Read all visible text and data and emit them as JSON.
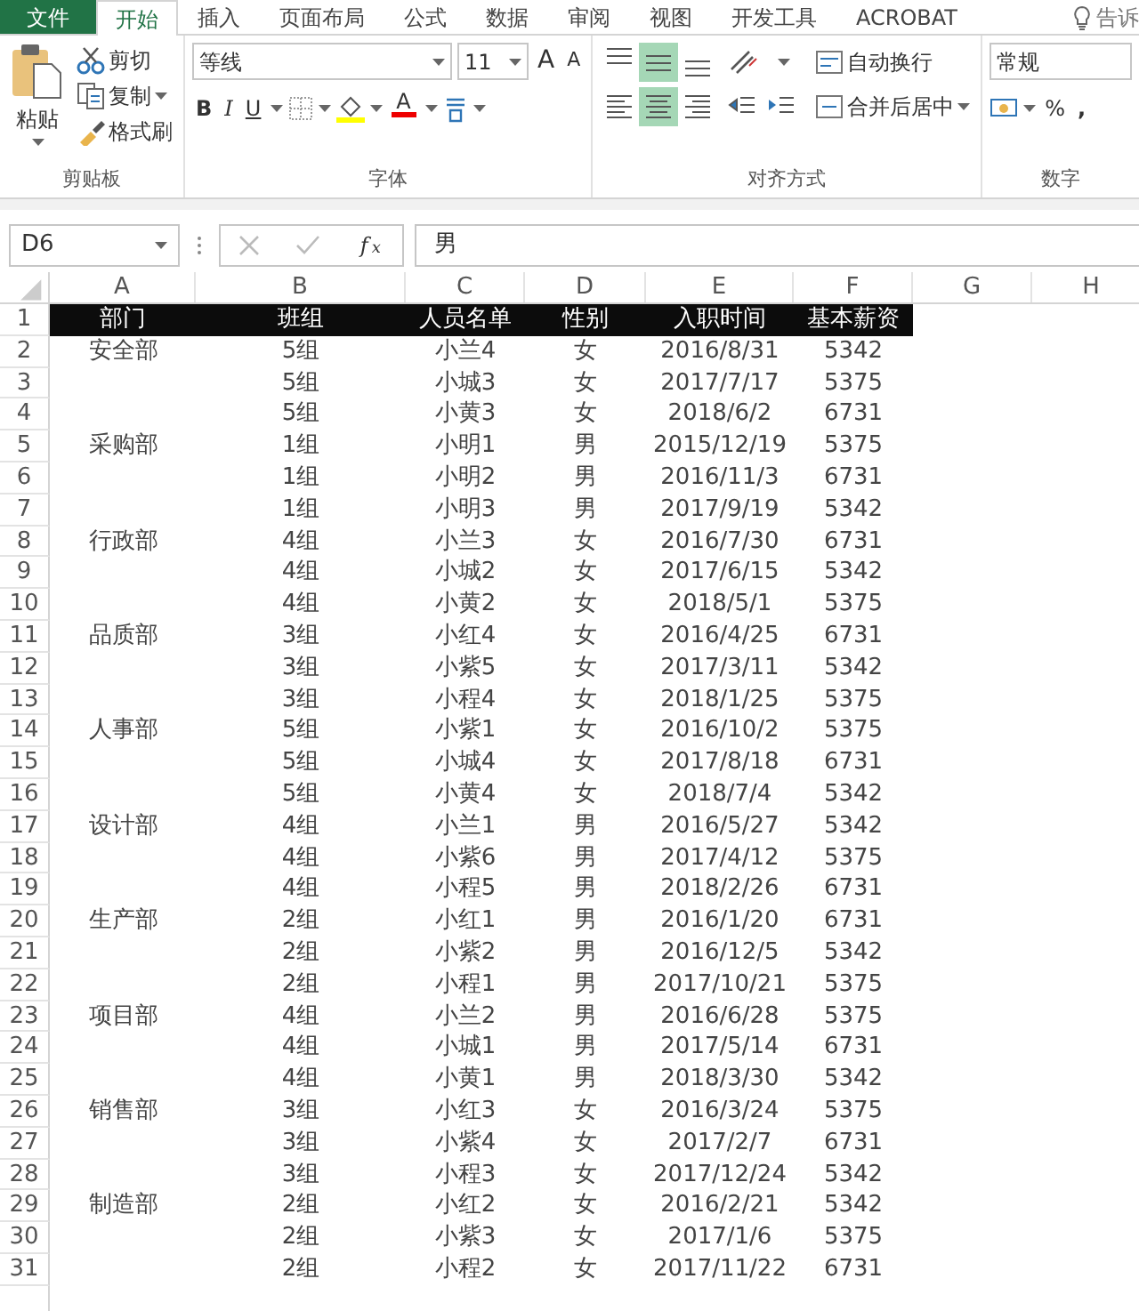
{
  "tabs": [
    {
      "label": "文件",
      "kind": "file",
      "selected": false
    },
    {
      "label": "开始",
      "kind": "tab",
      "selected": true
    },
    {
      "label": "插入",
      "kind": "tab",
      "selected": false
    },
    {
      "label": "页面布局",
      "kind": "tab",
      "selected": false
    },
    {
      "label": "公式",
      "kind": "tab",
      "selected": false
    },
    {
      "label": "数据",
      "kind": "tab",
      "selected": false
    },
    {
      "label": "审阅",
      "kind": "tab",
      "selected": false
    },
    {
      "label": "视图",
      "kind": "tab",
      "selected": false
    },
    {
      "label": "开发工具",
      "kind": "tab",
      "selected": false
    },
    {
      "label": "ACROBAT",
      "kind": "tab",
      "selected": false
    }
  ],
  "tell_me": "告诉",
  "clipboard": {
    "paste": "粘贴",
    "cut": "剪切",
    "copy": "复制",
    "format_painter": "格式刷",
    "label": "剪贴板"
  },
  "font": {
    "name": "等线",
    "size": "11",
    "grow": "A",
    "shrink": "A",
    "bold": "B",
    "italic": "I",
    "underline": "U",
    "color_letter": "A",
    "label": "字体"
  },
  "alignment": {
    "vertical": [
      {
        "kind": "top",
        "selected": false
      },
      {
        "kind": "middle",
        "selected": true
      },
      {
        "kind": "bottom",
        "selected": false
      }
    ],
    "horizontal": [
      {
        "kind": "left",
        "selected": false
      },
      {
        "kind": "center",
        "selected": true
      },
      {
        "kind": "right",
        "selected": false
      }
    ],
    "wrap": "自动换行",
    "merge": "合并后居中",
    "label": "对齐方式"
  },
  "number": {
    "format": "常规",
    "percent": "%",
    "comma": ",",
    "label": "数字"
  },
  "formula_bar": {
    "name_box": "D6",
    "fx": "f$_{x}$",
    "value": "男"
  },
  "sheet": {
    "columns": [
      "A",
      "B",
      "C",
      "D",
      "E",
      "F",
      "G",
      "H"
    ],
    "header": {
      "row": "1",
      "cells": [
        "部门",
        "班组",
        "人员名单",
        "性别",
        "入职时间",
        "基本薪资"
      ]
    },
    "rows": [
      {
        "row": "2",
        "department": "安全部",
        "group": "5组",
        "name": "小兰4",
        "gender": "女",
        "hire_date": "2016/8/31",
        "salary": "5342"
      },
      {
        "row": "3",
        "group": "5组",
        "name": "小城3",
        "gender": "女",
        "hire_date": "2017/7/17",
        "salary": "5375"
      },
      {
        "row": "4",
        "group": "5组",
        "name": "小黄3",
        "gender": "女",
        "hire_date": "2018/6/2",
        "salary": "6731"
      },
      {
        "row": "5",
        "department": "采购部",
        "group": "1组",
        "name": "小明1",
        "gender": "男",
        "hire_date": "2015/12/19",
        "salary": "5375"
      },
      {
        "row": "6",
        "group": "1组",
        "name": "小明2",
        "gender": "男",
        "hire_date": "2016/11/3",
        "salary": "6731"
      },
      {
        "row": "7",
        "group": "1组",
        "name": "小明3",
        "gender": "男",
        "hire_date": "2017/9/19",
        "salary": "5342"
      },
      {
        "row": "8",
        "department": "行政部",
        "group": "4组",
        "name": "小兰3",
        "gender": "女",
        "hire_date": "2016/7/30",
        "salary": "6731"
      },
      {
        "row": "9",
        "group": "4组",
        "name": "小城2",
        "gender": "女",
        "hire_date": "2017/6/15",
        "salary": "5342"
      },
      {
        "row": "10",
        "group": "4组",
        "name": "小黄2",
        "gender": "女",
        "hire_date": "2018/5/1",
        "salary": "5375"
      },
      {
        "row": "11",
        "department": "品质部",
        "group": "3组",
        "name": "小红4",
        "gender": "女",
        "hire_date": "2016/4/25",
        "salary": "6731"
      },
      {
        "row": "12",
        "group": "3组",
        "name": "小紫5",
        "gender": "女",
        "hire_date": "2017/3/11",
        "salary": "5342"
      },
      {
        "row": "13",
        "group": "3组",
        "name": "小程4",
        "gender": "女",
        "hire_date": "2018/1/25",
        "salary": "5375"
      },
      {
        "row": "14",
        "department": "人事部",
        "group": "5组",
        "name": "小紫1",
        "gender": "女",
        "hire_date": "2016/10/2",
        "salary": "5375"
      },
      {
        "row": "15",
        "group": "5组",
        "name": "小城4",
        "gender": "女",
        "hire_date": "2017/8/18",
        "salary": "6731"
      },
      {
        "row": "16",
        "group": "5组",
        "name": "小黄4",
        "gender": "女",
        "hire_date": "2018/7/4",
        "salary": "5342"
      },
      {
        "row": "17",
        "department": "设计部",
        "group": "4组",
        "name": "小兰1",
        "gender": "男",
        "hire_date": "2016/5/27",
        "salary": "5342"
      },
      {
        "row": "18",
        "group": "4组",
        "name": "小紫6",
        "gender": "男",
        "hire_date": "2017/4/12",
        "salary": "5375"
      },
      {
        "row": "19",
        "group": "4组",
        "name": "小程5",
        "gender": "男",
        "hire_date": "2018/2/26",
        "salary": "6731"
      },
      {
        "row": "20",
        "department": "生产部",
        "group": "2组",
        "name": "小红1",
        "gender": "男",
        "hire_date": "2016/1/20",
        "salary": "6731"
      },
      {
        "row": "21",
        "group": "2组",
        "name": "小紫2",
        "gender": "男",
        "hire_date": "2016/12/5",
        "salary": "5342"
      },
      {
        "row": "22",
        "group": "2组",
        "name": "小程1",
        "gender": "男",
        "hire_date": "2017/10/21",
        "salary": "5375"
      },
      {
        "row": "23",
        "department": "项目部",
        "group": "4组",
        "name": "小兰2",
        "gender": "男",
        "hire_date": "2016/6/28",
        "salary": "5375"
      },
      {
        "row": "24",
        "group": "4组",
        "name": "小城1",
        "gender": "男",
        "hire_date": "2017/5/14",
        "salary": "6731"
      },
      {
        "row": "25",
        "group": "4组",
        "name": "小黄1",
        "gender": "男",
        "hire_date": "2018/3/30",
        "salary": "5342"
      },
      {
        "row": "26",
        "department": "销售部",
        "group": "3组",
        "name": "小红3",
        "gender": "女",
        "hire_date": "2016/3/24",
        "salary": "5375"
      },
      {
        "row": "27",
        "group": "3组",
        "name": "小紫4",
        "gender": "女",
        "hire_date": "2017/2/7",
        "salary": "6731"
      },
      {
        "row": "28",
        "group": "3组",
        "name": "小程3",
        "gender": "女",
        "hire_date": "2017/12/24",
        "salary": "5342"
      },
      {
        "row": "29",
        "department": "制造部",
        "group": "2组",
        "name": "小红2",
        "gender": "女",
        "hire_date": "2016/2/21",
        "salary": "5342"
      },
      {
        "row": "30",
        "group": "2组",
        "name": "小紫3",
        "gender": "女",
        "hire_date": "2017/1/6",
        "salary": "5375"
      },
      {
        "row": "31",
        "group": "2组",
        "name": "小程2",
        "gender": "女",
        "hire_date": "2017/11/22",
        "salary": "6731"
      }
    ]
  }
}
